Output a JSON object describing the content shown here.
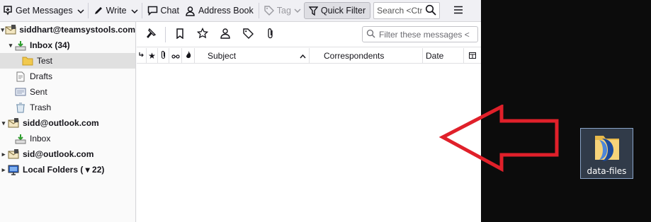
{
  "toolbar": {
    "get_messages": "Get Messages",
    "write": "Write",
    "chat": "Chat",
    "address_book": "Address Book",
    "tag": "Tag",
    "quick_filter": "Quick Filter",
    "search_placeholder": "Search <Ctr"
  },
  "folders": [
    {
      "label": "siddhart@teamsystools.com",
      "kind": "account"
    },
    {
      "label": "Inbox (34)",
      "kind": "inbox"
    },
    {
      "label": "Test",
      "kind": "folder"
    },
    {
      "label": "Drafts",
      "kind": "drafts"
    },
    {
      "label": "Sent",
      "kind": "sent"
    },
    {
      "label": "Trash",
      "kind": "trash"
    },
    {
      "label": "sidd@outlook.com",
      "kind": "account"
    },
    {
      "label": "Inbox",
      "kind": "inbox"
    },
    {
      "label": "sid@outlook.com",
      "kind": "account"
    },
    {
      "label": "Local Folders ( ▾ 22)",
      "kind": "local"
    }
  ],
  "quickfilter": {
    "filter_placeholder": "Filter these messages <"
  },
  "columns": {
    "subject": "Subject",
    "correspondents": "Correspondents",
    "date": "Date"
  },
  "desktop": {
    "icon_label": "data-files"
  },
  "colors": {
    "accent_arrow": "#e0202a",
    "desktop_bg": "#0c0c0c"
  }
}
